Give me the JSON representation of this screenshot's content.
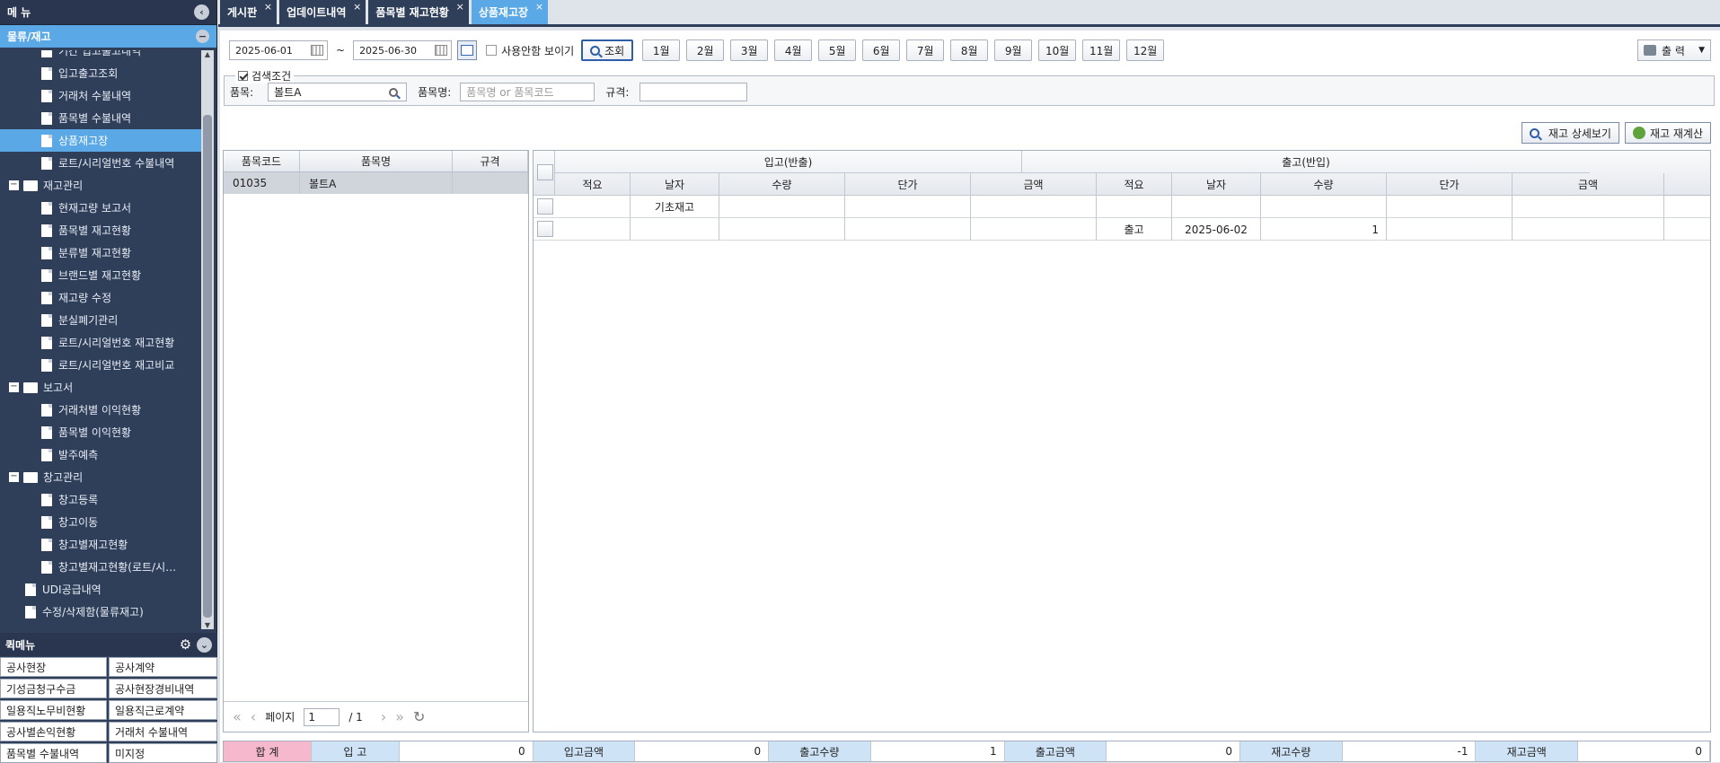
{
  "sidebar": {
    "title": "메 뉴",
    "category": "물류/재고",
    "items": [
      {
        "label": "기간 입고출고내역",
        "level": 2,
        "type": "doc"
      },
      {
        "label": "입고출고조회",
        "level": 2,
        "type": "doc"
      },
      {
        "label": "거래처 수불내역",
        "level": 2,
        "type": "doc"
      },
      {
        "label": "품목별 수불내역",
        "level": 2,
        "type": "doc"
      },
      {
        "label": "상품재고장",
        "level": 2,
        "type": "doc",
        "selected": true
      },
      {
        "label": "로트/시리얼번호 수불내역",
        "level": 2,
        "type": "doc"
      },
      {
        "label": "재고관리",
        "level": 1,
        "type": "folder"
      },
      {
        "label": "현재고량 보고서",
        "level": 2,
        "type": "doc"
      },
      {
        "label": "품목별 재고현황",
        "level": 2,
        "type": "doc"
      },
      {
        "label": "분류별 재고현황",
        "level": 2,
        "type": "doc"
      },
      {
        "label": "브랜드별 재고현황",
        "level": 2,
        "type": "doc"
      },
      {
        "label": "재고량 수정",
        "level": 2,
        "type": "doc"
      },
      {
        "label": "분실폐기관리",
        "level": 2,
        "type": "doc"
      },
      {
        "label": "로트/시리얼번호 재고현황",
        "level": 2,
        "type": "doc"
      },
      {
        "label": "로트/시리얼번호 재고비교",
        "level": 2,
        "type": "doc"
      },
      {
        "label": "보고서",
        "level": 1,
        "type": "folder"
      },
      {
        "label": "거래처별 이익현황",
        "level": 2,
        "type": "doc"
      },
      {
        "label": "품목별 이익현황",
        "level": 2,
        "type": "doc"
      },
      {
        "label": "발주예측",
        "level": 2,
        "type": "doc"
      },
      {
        "label": "창고관리",
        "level": 1,
        "type": "folder"
      },
      {
        "label": "창고등록",
        "level": 2,
        "type": "doc"
      },
      {
        "label": "창고이동",
        "level": 2,
        "type": "doc"
      },
      {
        "label": "창고별재고현황",
        "level": 2,
        "type": "doc"
      },
      {
        "label": "창고별재고현황(로트/시…",
        "level": 2,
        "type": "doc"
      },
      {
        "label": "UDI공급내역",
        "level": 1,
        "type": "doc"
      },
      {
        "label": "수정/삭제함(물류재고)",
        "level": 1,
        "type": "doc"
      }
    ]
  },
  "quick": {
    "title": "퀵메뉴",
    "items": [
      "공사현장",
      "공사계약",
      "기성금청구수금",
      "공사현장경비내역",
      "일용직노무비현황",
      "일용직근로계약",
      "공사별손익현황",
      "거래처 수불내역",
      "품목별 수불내역",
      "미지정"
    ]
  },
  "tabs": [
    {
      "label": "게시판"
    },
    {
      "label": "업데이트내역"
    },
    {
      "label": "품목별 재고현황"
    },
    {
      "label": "상품재고장",
      "active": true
    }
  ],
  "toolbar": {
    "date_from": "2025-06-01",
    "tilde": "~",
    "date_to": "2025-06-30",
    "show_unused": "사용안함 보이기",
    "search": "조회",
    "months": [
      "1월",
      "2월",
      "3월",
      "4월",
      "5월",
      "6월",
      "7월",
      "8월",
      "9월",
      "10월",
      "11월",
      "12월"
    ],
    "print": "출 력"
  },
  "filter": {
    "legend": "검색조건",
    "item_label": "품목:",
    "item_value": "볼트A",
    "name_label": "품목명:",
    "name_placeholder": "품목명 or 품목코드",
    "spec_label": "규격:",
    "spec_value": ""
  },
  "actions": {
    "detail": "재고 상세보기",
    "recalc": "재고 재계산"
  },
  "left_grid": {
    "headers": [
      "품목코드",
      "품목명",
      "규격"
    ],
    "rows": [
      {
        "code": "01035",
        "name": "볼트A",
        "spec": ""
      }
    ],
    "pager": {
      "label": "페이지",
      "page": "1",
      "total": "/ 1"
    }
  },
  "right_grid": {
    "group_in": "입고(반출)",
    "group_out": "출고(반입)",
    "sub_headers": [
      "적요",
      "날자",
      "수량",
      "단가",
      "금액",
      "적요",
      "날자",
      "수량",
      "단가",
      "금액"
    ],
    "rows": [
      [
        "",
        "기초재고",
        "",
        "",
        "",
        "",
        "",
        "",
        "",
        ""
      ],
      [
        "",
        "",
        "",
        "",
        "",
        "출고",
        "2025-06-02",
        "1",
        "",
        ""
      ]
    ]
  },
  "footer": [
    {
      "label": "합 계",
      "value": null,
      "pink": true
    },
    {
      "label": "입 고",
      "value": "0"
    },
    {
      "label": "입고금액",
      "value": "0"
    },
    {
      "label": "출고수량",
      "value": "1"
    },
    {
      "label": "출고금액",
      "value": "0"
    },
    {
      "label": "재고수량",
      "value": "-1"
    },
    {
      "label": "재고금액",
      "value": "0"
    }
  ]
}
